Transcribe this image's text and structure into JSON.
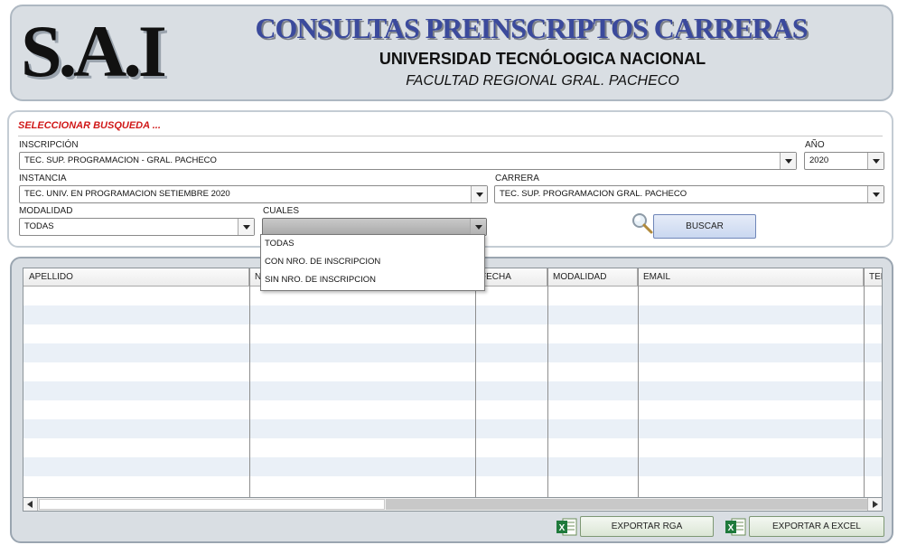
{
  "header": {
    "logo": "S.A.I",
    "title": "CONSULTAS PREINSCRIPTOS CARRERAS",
    "university": "UNIVERSIDAD TECNÓLOGICA NACIONAL",
    "faculty": "FACULTAD REGIONAL GRAL. PACHECO"
  },
  "search": {
    "section_title": "SELECCIONAR BUSQUEDA ...",
    "inscripcion": {
      "label": "INSCRIPCIÓN",
      "value": "TEC. SUP. PROGRAMACION  - GRAL. PACHECO"
    },
    "anio": {
      "label": "AÑO",
      "value": "2020"
    },
    "instancia": {
      "label": "INSTANCIA",
      "value": "TEC. UNIV. EN PROGRAMACION SETIEMBRE 2020"
    },
    "carrera": {
      "label": "CARRERA",
      "value": "TEC. SUP. PROGRAMACION GRAL. PACHECO"
    },
    "modalidad": {
      "label": "MODALIDAD",
      "value": "TODAS"
    },
    "cuales": {
      "label": "CUALES",
      "value": "",
      "options": [
        "TODAS",
        "CON NRO. DE INSCRIPCION",
        "SIN NRO. DE INSCRIPCION"
      ]
    },
    "buscar_label": "BUSCAR",
    "search_icon": "magnifier-icon"
  },
  "grid": {
    "columns": [
      "APELLIDO",
      "N",
      "FECHA",
      "MODALIDAD",
      "EMAIL",
      "TEL"
    ],
    "rows": []
  },
  "actions": {
    "export_rga_label": "EXPORTAR RGA",
    "export_excel_label": "EXPORTAR A EXCEL",
    "excel_icon": "excel-icon"
  },
  "colors": {
    "title_blue": "#3b4a9c",
    "section_red": "#d01818",
    "panel_grey": "#d9dee3",
    "row_alt": "#eaf0f7"
  }
}
